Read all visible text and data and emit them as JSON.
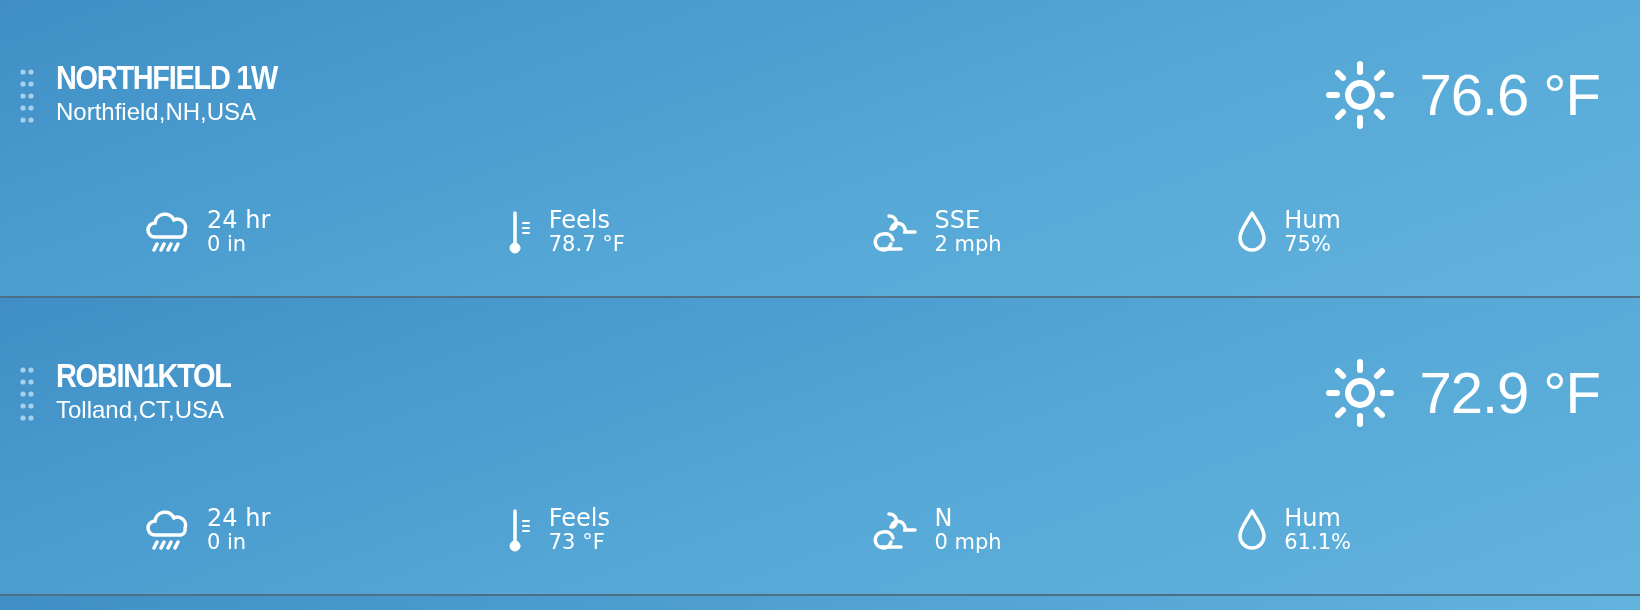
{
  "stations": [
    {
      "name": "NORTHFIELD 1W",
      "location": "Northfield,NH,USA",
      "kind": "sunny",
      "temperature": "76.6 °F",
      "stats": [
        {
          "kind": "rain",
          "label": "24 hr",
          "value": "0 in"
        },
        {
          "kind": "feels",
          "label": "Feels",
          "value": "78.7 °F"
        },
        {
          "kind": "wind",
          "label": "SSE",
          "value": "2 mph"
        },
        {
          "kind": "humidity",
          "label": "Hum",
          "value": "75%"
        }
      ]
    },
    {
      "name": "ROBIN1KTOL",
      "location": "Tolland,CT,USA",
      "kind": "sunny",
      "temperature": "72.9 °F",
      "stats": [
        {
          "kind": "rain",
          "label": "24 hr",
          "value": "0 in"
        },
        {
          "kind": "feels",
          "label": "Feels",
          "value": "73 °F"
        },
        {
          "kind": "wind",
          "label": "N",
          "value": "0 mph"
        },
        {
          "kind": "humidity",
          "label": "Hum",
          "value": "61.1%"
        }
      ]
    }
  ]
}
